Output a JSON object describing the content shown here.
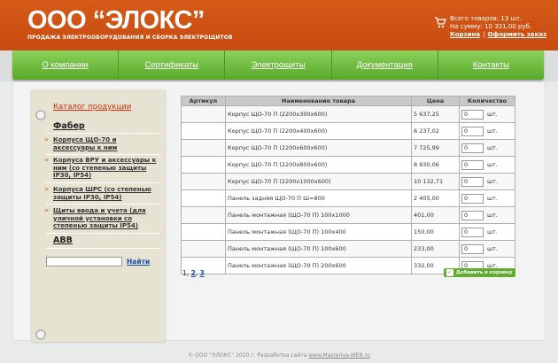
{
  "header": {
    "logo": "ООО “ЭЛОКС”",
    "tagline": "ПРОДАЖА ЭЛЕКТРООБОРУДОВАНИЯ И СБОРКА ЭЛЕКТРОЩИТОВ",
    "cart_total_items": "Всего товаров: 13 шт.",
    "cart_total_sum": "На сумму: 10 331,00 руб.",
    "cart_link": "Корзина",
    "separator": "|",
    "checkout_link": "Оформить заказ"
  },
  "nav": [
    "О компании",
    "Сертификаты",
    "Электрощиты",
    "Документация",
    "Контакты"
  ],
  "sidebar": {
    "title": "Каталог продукции",
    "sections": [
      {
        "label": "Фабер"
      },
      {
        "label": "ABB"
      }
    ],
    "items": [
      "Корпуса ЩО-70 и аксессуары к ним",
      "Корпуса ВРУ и аксессуары к ним (со степенью защиты IP30, IP54)",
      "Корпуса ШРС (со степенью защиты IP30, IP54)",
      "Щиты ввода и учета (для уличной установки со степенью защиты IP54)"
    ],
    "search_value": "",
    "search_button": "Найти"
  },
  "table": {
    "headers": [
      "Артикул",
      "Наименование товара",
      "Цена",
      "Количество"
    ],
    "unit": "шт.",
    "rows": [
      {
        "sku": "",
        "name": "Корпус ЩО-70 П (2200х300х600)",
        "price": "5 637,25",
        "qty": "0"
      },
      {
        "sku": "",
        "name": "Корпус ЩО-70 П (2200х400х600)",
        "price": "6 237,02",
        "qty": "0"
      },
      {
        "sku": "",
        "name": "Корпус ЩО-70 П (2200х600х600)",
        "price": "7 725,99",
        "qty": "0"
      },
      {
        "sku": "",
        "name": "Корпус ЩО-70 П (2200х800х600)",
        "price": "8 930,06",
        "qty": "0"
      },
      {
        "sku": "",
        "name": "Корпус ЩО-70 П (2200х1000х600)",
        "price": "10 132,71",
        "qty": "0"
      },
      {
        "sku": "",
        "name": "Панель задняя ЩО-70 П Ш=800",
        "price": "2 405,00",
        "qty": "0"
      },
      {
        "sku": "",
        "name": "Панель монтажная (ЩО-70 П) 100х1000",
        "price": "401,00",
        "qty": "0"
      },
      {
        "sku": "",
        "name": "Панель монтажная (ЩО-70 П) 100х400",
        "price": "150,00",
        "qty": "0"
      },
      {
        "sku": "",
        "name": "Панель монтажная (ЩО-70 П) 100х600",
        "price": "233,00",
        "qty": "0"
      },
      {
        "sku": "",
        "name": "Панель монтажная (ЩО-70 П) 200х600",
        "price": "332,00",
        "qty": "0"
      }
    ]
  },
  "pagination": {
    "current": "1",
    "sep": ",",
    "pages": [
      "2",
      "3"
    ]
  },
  "add_to_cart": "Добавить в корзину",
  "footer": {
    "text": "© ООО “ЭЛОКС” 2010 г. Разработка сайта",
    "link": "www.Masteriya-WEB.ru"
  }
}
